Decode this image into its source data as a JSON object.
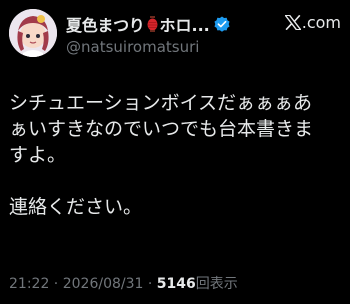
{
  "post": {
    "display_name": "夏色まつり",
    "display_name_tail": "ホロ...",
    "handle": "@natsuiromatsuri",
    "brand_suffix": ".com",
    "body_lines": [
      "シチュエーションボイスだぁぁぁあ",
      "ぁいすきなのでいつでも台本書きま",
      "すよ。",
      "連絡ください。"
    ],
    "time": "21:22",
    "separator": " · ",
    "date": "2026/08/31",
    "views_count": "5146",
    "views_label": "回表示"
  },
  "colors": {
    "background": "#000000",
    "primary_text": "#e7e9ea",
    "secondary_text": "#71767b",
    "verified_blue": "#1d9bf0",
    "lantern_red": "#d6252b"
  },
  "icons": {
    "lantern": "lantern-icon",
    "verified": "verified-badge-icon",
    "brand_logo": "x-logo-icon"
  }
}
